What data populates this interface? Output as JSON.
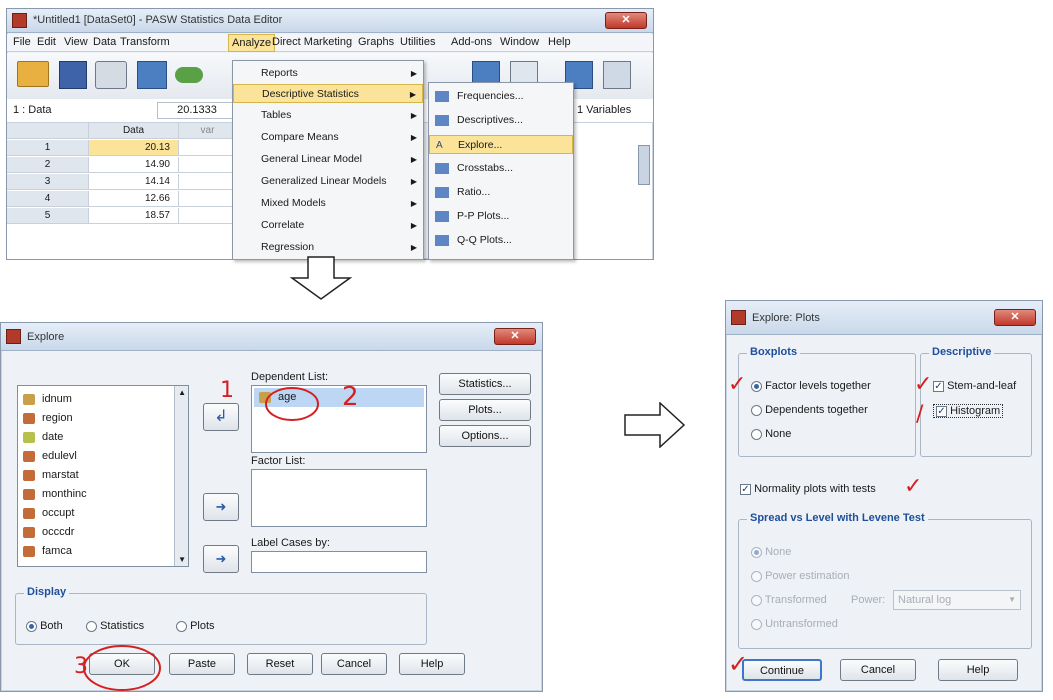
{
  "data_editor": {
    "title": "*Untitled1 [DataSet0] - PASW Statistics Data Editor",
    "menus": [
      "File",
      "Edit",
      "View",
      "Data",
      "Transform",
      "Analyze",
      "Direct Marketing",
      "Graphs",
      "Utilities",
      "Add-ons",
      "Window",
      "Help"
    ],
    "cell_ref": "1 : Data",
    "cell_value": "20.1333",
    "visible_count": "1 Variables",
    "column_header": "Data",
    "column_header2": "var",
    "rows": [
      {
        "n": "1",
        "v": "20.13"
      },
      {
        "n": "2",
        "v": "14.90"
      },
      {
        "n": "3",
        "v": "14.14"
      },
      {
        "n": "4",
        "v": "12.66"
      },
      {
        "n": "5",
        "v": "18.57"
      }
    ],
    "analyze_menu": [
      "Reports",
      "Descriptive Statistics",
      "Tables",
      "Compare Means",
      "General Linear Model",
      "Generalized Linear Models",
      "Mixed Models",
      "Correlate",
      "Regression"
    ],
    "descriptive_submenu": [
      "Frequencies...",
      "Descriptives...",
      "Explore...",
      "Crosstabs...",
      "Ratio...",
      "P-P Plots...",
      "Q-Q Plots..."
    ]
  },
  "explore": {
    "title": "Explore",
    "variables": [
      "idnum",
      "region",
      "date",
      "edulevl",
      "marstat",
      "monthinc",
      "occupt",
      "occcdr",
      "famca"
    ],
    "dependent_label": "Dependent List:",
    "dependent_item": "age",
    "factor_label": "Factor List:",
    "label_cases_label": "Label Cases by:",
    "side_buttons": [
      "Statistics...",
      "Plots...",
      "Options..."
    ],
    "display_label": "Display",
    "display_options": [
      "Both",
      "Statistics",
      "Plots"
    ],
    "bottom_buttons": [
      "OK",
      "Paste",
      "Reset",
      "Cancel",
      "Help"
    ],
    "annotations": [
      "1",
      "2",
      "3"
    ]
  },
  "plots": {
    "title": "Explore: Plots",
    "boxplots_label": "Boxplots",
    "boxplot_options": [
      "Factor levels together",
      "Dependents together",
      "None"
    ],
    "descriptive_label": "Descriptive",
    "descriptive_options": [
      "Stem-and-leaf",
      "Histogram"
    ],
    "normality_label": "Normality plots with tests",
    "spread_label": "Spread vs Level with Levene Test",
    "spread_options": [
      "None",
      "Power estimation",
      "Transformed",
      "Untransformed"
    ],
    "power_label": "Power:",
    "power_value": "Natural log",
    "buttons": [
      "Continue",
      "Cancel",
      "Help"
    ]
  },
  "colors": {
    "annotation": "#d42020",
    "group_label": "#1f4f9a",
    "highlight": "#fbe39a"
  }
}
